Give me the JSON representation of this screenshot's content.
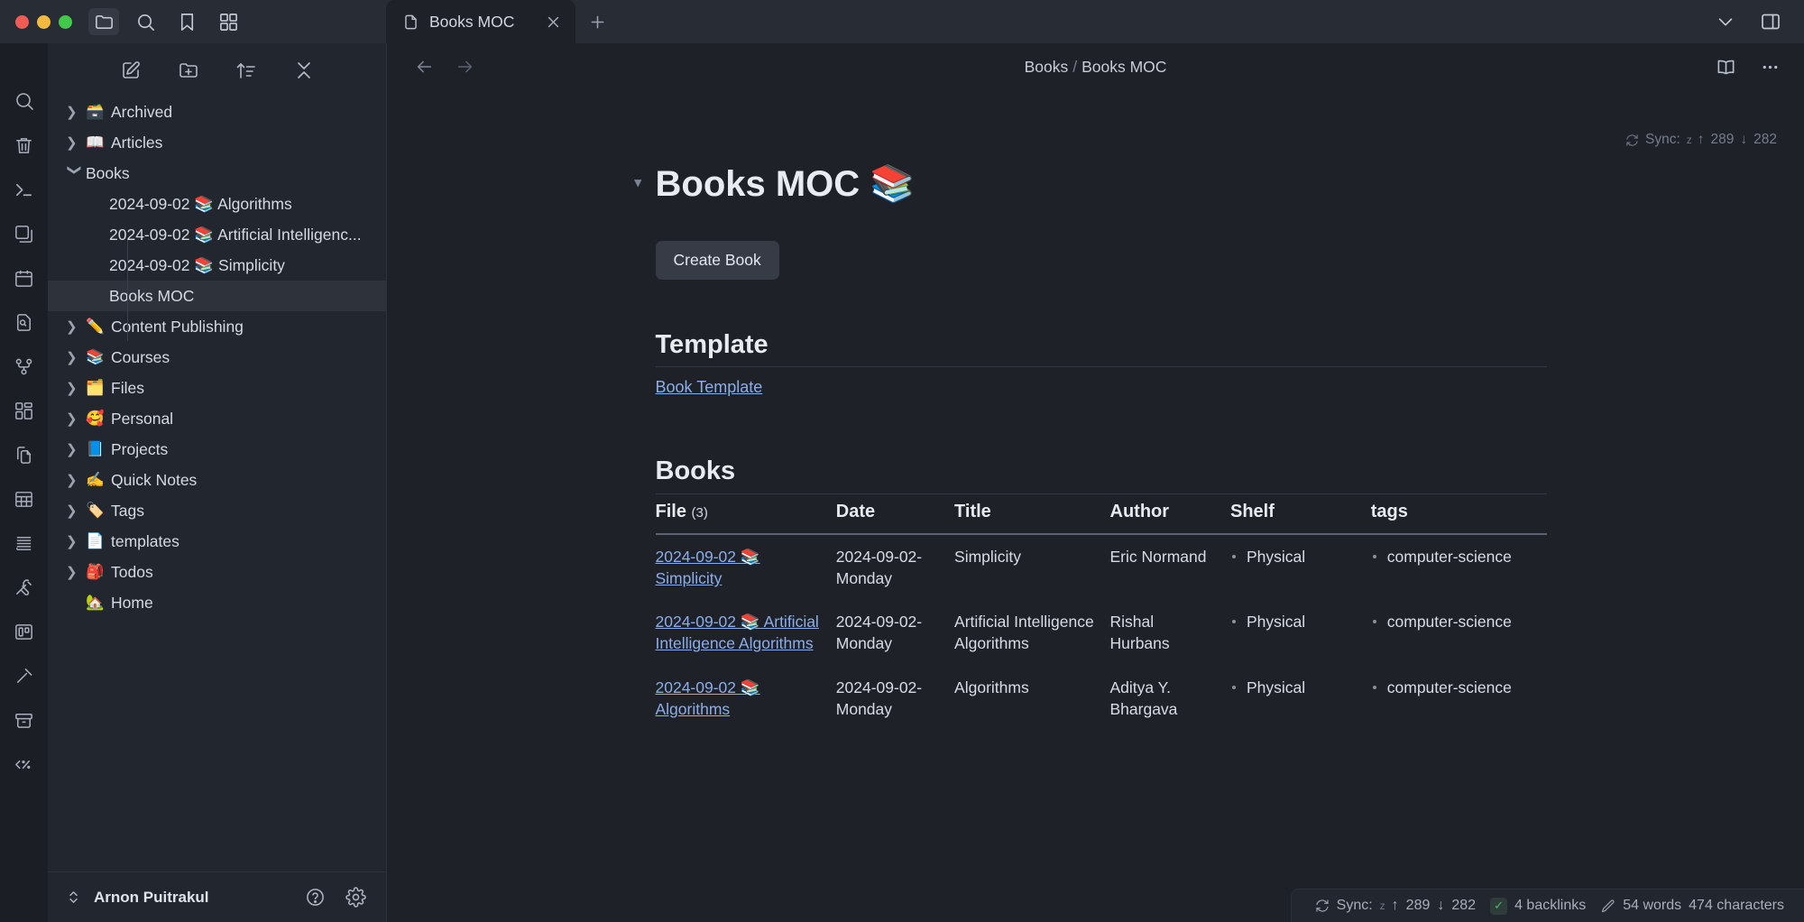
{
  "window": {
    "traffic_lights": [
      "close",
      "minimize",
      "maximize"
    ],
    "toolbar_icons": [
      "folder-icon",
      "search-icon",
      "bookmark-icon",
      "grid-icon",
      "sidebar-toggle-icon"
    ]
  },
  "tab": {
    "title": "Books MOC",
    "icon": "file-icon",
    "close_label": "×",
    "new_tab_label": "+"
  },
  "ribbon": {
    "icons": [
      "search-icon",
      "trash-icon",
      "terminal-icon",
      "copy-window-icon",
      "calendar-icon",
      "file-search-icon",
      "git-graph-icon",
      "dashboard-icon",
      "duplicate-file-icon",
      "table-icon",
      "list-lines-icon",
      "tools-icon",
      "kanban-icon",
      "magic-wand-icon",
      "archive-icon",
      "code-percent-icon"
    ]
  },
  "explorer": {
    "toolbar_icons": [
      "new-note-icon",
      "new-folder-icon",
      "sort-icon",
      "collapse-all-icon"
    ],
    "tree": [
      {
        "label": "Archived",
        "emoji": "🗃️",
        "type": "folder",
        "expanded": false,
        "indent": 0
      },
      {
        "label": "Articles",
        "emoji": "📖",
        "type": "folder",
        "expanded": false,
        "indent": 0
      },
      {
        "label": "Books",
        "emoji": "",
        "type": "folder",
        "expanded": true,
        "indent": 0
      },
      {
        "label": "2024-09-02 📚 Algorithms",
        "emoji": "",
        "type": "file",
        "indent": 1
      },
      {
        "label": "2024-09-02 📚 Artificial Intelligenc...",
        "emoji": "",
        "type": "file",
        "indent": 1
      },
      {
        "label": "2024-09-02 📚 Simplicity",
        "emoji": "",
        "type": "file",
        "indent": 1
      },
      {
        "label": "Books MOC",
        "emoji": "",
        "type": "file",
        "indent": 1,
        "selected": true
      },
      {
        "label": "Content Publishing",
        "emoji": "✏️",
        "type": "folder",
        "expanded": false,
        "indent": 0
      },
      {
        "label": "Courses",
        "emoji": "📚",
        "type": "folder",
        "expanded": false,
        "indent": 0
      },
      {
        "label": "Files",
        "emoji": "🗂️",
        "type": "folder",
        "expanded": false,
        "indent": 0
      },
      {
        "label": "Personal",
        "emoji": "🥰",
        "type": "folder",
        "expanded": false,
        "indent": 0
      },
      {
        "label": "Projects",
        "emoji": "📘",
        "type": "folder",
        "expanded": false,
        "indent": 0
      },
      {
        "label": "Quick Notes",
        "emoji": "✍️",
        "type": "folder",
        "expanded": false,
        "indent": 0
      },
      {
        "label": "Tags",
        "emoji": "🏷️",
        "type": "folder",
        "expanded": false,
        "indent": 0
      },
      {
        "label": "templates",
        "emoji": "📄",
        "type": "folder",
        "expanded": false,
        "indent": 0
      },
      {
        "label": "Todos",
        "emoji": "🎒",
        "type": "folder",
        "expanded": false,
        "indent": 0
      },
      {
        "label": "Home",
        "emoji": "🏡",
        "type": "file",
        "indent": 0
      }
    ],
    "footer": {
      "user_name": "Arnon Puitrakul",
      "switch_icon": "vault-switch-icon",
      "help_icon": "help-icon",
      "settings_icon": "gear-icon"
    }
  },
  "header": {
    "back_icon": "arrow-left-icon",
    "forward_icon": "arrow-right-icon",
    "breadcrumb": [
      "Books",
      "Books MOC"
    ],
    "breadcrumb_separator": "/",
    "reading_view_icon": "book-open-icon",
    "more_options_icon": "more-horizontal-icon"
  },
  "sync_top": {
    "icon": "sync-icon",
    "label": "Sync:",
    "sleep_indicator": "z",
    "up_arrow": "↑",
    "up_count": "289",
    "down_arrow": "↓",
    "down_count": "282"
  },
  "document": {
    "title": "Books MOC 📚",
    "fold_icon": "chevron-down-icon",
    "create_button": "Create Book",
    "template_heading": "Template",
    "template_link": "Book Template",
    "books_heading": "Books"
  },
  "table": {
    "columns": [
      {
        "key": "file",
        "label": "File",
        "count": "(3)"
      },
      {
        "key": "date",
        "label": "Date",
        "count": ""
      },
      {
        "key": "title",
        "label": "Title",
        "count": ""
      },
      {
        "key": "author",
        "label": "Author",
        "count": ""
      },
      {
        "key": "shelf",
        "label": "Shelf",
        "count": ""
      },
      {
        "key": "tags",
        "label": "tags",
        "count": ""
      }
    ],
    "rows": [
      {
        "file": "2024-09-02 📚 Simplicity",
        "date": "2024-09-02-Monday",
        "title": "Simplicity",
        "author": "Eric Normand",
        "shelf": "Physical",
        "tags": "computer-science"
      },
      {
        "file": "2024-09-02 📚 Artificial Intelligence Algorithms",
        "date": "2024-09-02-Monday",
        "title": "Artificial Intelligence Algorithms",
        "author": "Rishal Hurbans",
        "shelf": "Physical",
        "tags": "computer-science"
      },
      {
        "file": "2024-09-02 📚 Algorithms",
        "date": "2024-09-02-Monday",
        "title": "Algorithms",
        "author": "Aditya Y. Bhargava",
        "shelf": "Physical",
        "tags": "computer-science"
      }
    ]
  },
  "statusbar": {
    "sync_icon": "sync-icon",
    "sync_label": "Sync:",
    "sleep_indicator": "z",
    "up_arrow": "↑",
    "up_count": "289",
    "down_arrow": "↓",
    "down_count": "282",
    "checkbox_icon": "tasks-checked-icon",
    "backlinks": "4 backlinks",
    "pencil_icon": "pencil-icon",
    "words": "54 words",
    "characters": "474 characters"
  },
  "colors": {
    "background": "#1e2128",
    "sidebar": "#22262e",
    "ribbon": "#1b1e25",
    "titlebar": "#282c35",
    "accent_link": "#8caee8",
    "text": "#d5dae3"
  }
}
